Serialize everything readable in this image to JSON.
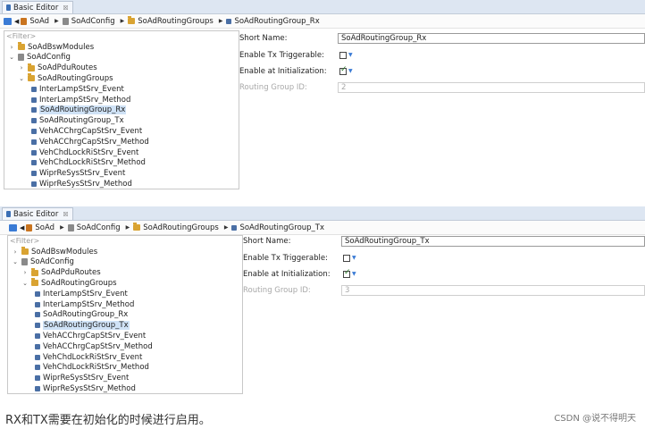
{
  "panels": [
    {
      "tab_title": "Basic Editor",
      "tab_close": "☒",
      "breadcrumb": [
        "SoAd",
        "SoAdConfig",
        "SoAdRoutingGroups",
        "SoAdRoutingGroup_Rx"
      ],
      "filter_placeholder": "<Filter>",
      "tree": [
        {
          "label": "SoAdBswModules",
          "twisty": "›",
          "icon": "folder"
        },
        {
          "label": "SoAdConfig",
          "twisty": "⌄",
          "icon": "config"
        },
        {
          "label": "SoAdPduRoutes",
          "twisty": "›",
          "icon": "folder"
        },
        {
          "label": "SoAdRoutingGroups",
          "twisty": "⌄",
          "icon": "folder"
        },
        {
          "label": "InterLampStSrv_Event",
          "twisty": "",
          "icon": "item"
        },
        {
          "label": "InterLampStSrv_Method",
          "twisty": "",
          "icon": "item"
        },
        {
          "label": "SoAdRoutingGroup_Rx",
          "twisty": "",
          "icon": "item"
        },
        {
          "label": "SoAdRoutingGroup_Tx",
          "twisty": "",
          "icon": "item"
        },
        {
          "label": "VehACChrgCapStSrv_Event",
          "twisty": "",
          "icon": "item"
        },
        {
          "label": "VehACChrgCapStSrv_Method",
          "twisty": "",
          "icon": "item"
        },
        {
          "label": "VehChdLockRiStSrv_Event",
          "twisty": "",
          "icon": "item"
        },
        {
          "label": "VehChdLockRiStSrv_Method",
          "twisty": "",
          "icon": "item"
        },
        {
          "label": "WiprReSysStSrv_Event",
          "twisty": "",
          "icon": "item"
        },
        {
          "label": "WiprReSysStSrv_Method",
          "twisty": "",
          "icon": "item"
        }
      ],
      "selected_index": 6,
      "form": {
        "short_name_label": "Short Name:",
        "short_name_value": "SoAdRoutingGroup_Rx",
        "tx_triggerable_label": "Enable Tx Triggerable:",
        "tx_triggerable_checked": false,
        "enable_init_label": "Enable at Initialization:",
        "enable_init_checked": true,
        "routing_group_id_label": "Routing Group ID:",
        "routing_group_id_value": "2"
      }
    },
    {
      "tab_title": "Basic Editor",
      "tab_close": "☒",
      "breadcrumb": [
        "SoAd",
        "SoAdConfig",
        "SoAdRoutingGroups",
        "SoAdRoutingGroup_Tx"
      ],
      "filter_placeholder": "<Filter>",
      "tree": [
        {
          "label": "SoAdBswModules",
          "twisty": "›",
          "icon": "folder"
        },
        {
          "label": "SoAdConfig",
          "twisty": "⌄",
          "icon": "config"
        },
        {
          "label": "SoAdPduRoutes",
          "twisty": "›",
          "icon": "folder"
        },
        {
          "label": "SoAdRoutingGroups",
          "twisty": "⌄",
          "icon": "folder"
        },
        {
          "label": "InterLampStSrv_Event",
          "twisty": "",
          "icon": "item"
        },
        {
          "label": "InterLampStSrv_Method",
          "twisty": "",
          "icon": "item"
        },
        {
          "label": "SoAdRoutingGroup_Rx",
          "twisty": "",
          "icon": "item"
        },
        {
          "label": "SoAdRoutingGroup_Tx",
          "twisty": "",
          "icon": "item"
        },
        {
          "label": "VehACChrgCapStSrv_Event",
          "twisty": "",
          "icon": "item"
        },
        {
          "label": "VehACChrgCapStSrv_Method",
          "twisty": "",
          "icon": "item"
        },
        {
          "label": "VehChdLockRiStSrv_Event",
          "twisty": "",
          "icon": "item"
        },
        {
          "label": "VehChdLockRiStSrv_Method",
          "twisty": "",
          "icon": "item"
        },
        {
          "label": "WiprReSysStSrv_Event",
          "twisty": "",
          "icon": "item"
        },
        {
          "label": "WiprReSysStSrv_Method",
          "twisty": "",
          "icon": "item"
        }
      ],
      "selected_index": 7,
      "form": {
        "short_name_label": "Short Name:",
        "short_name_value": "SoAdRoutingGroup_Tx",
        "tx_triggerable_label": "Enable Tx Triggerable:",
        "tx_triggerable_checked": false,
        "enable_init_label": "Enable at Initialization:",
        "enable_init_checked": true,
        "routing_group_id_label": "Routing Group ID:",
        "routing_group_id_value": "3"
      }
    }
  ],
  "caption": "RX和TX需要在初始化的时候进行启用。",
  "credit": "CSDN @说不得明天"
}
